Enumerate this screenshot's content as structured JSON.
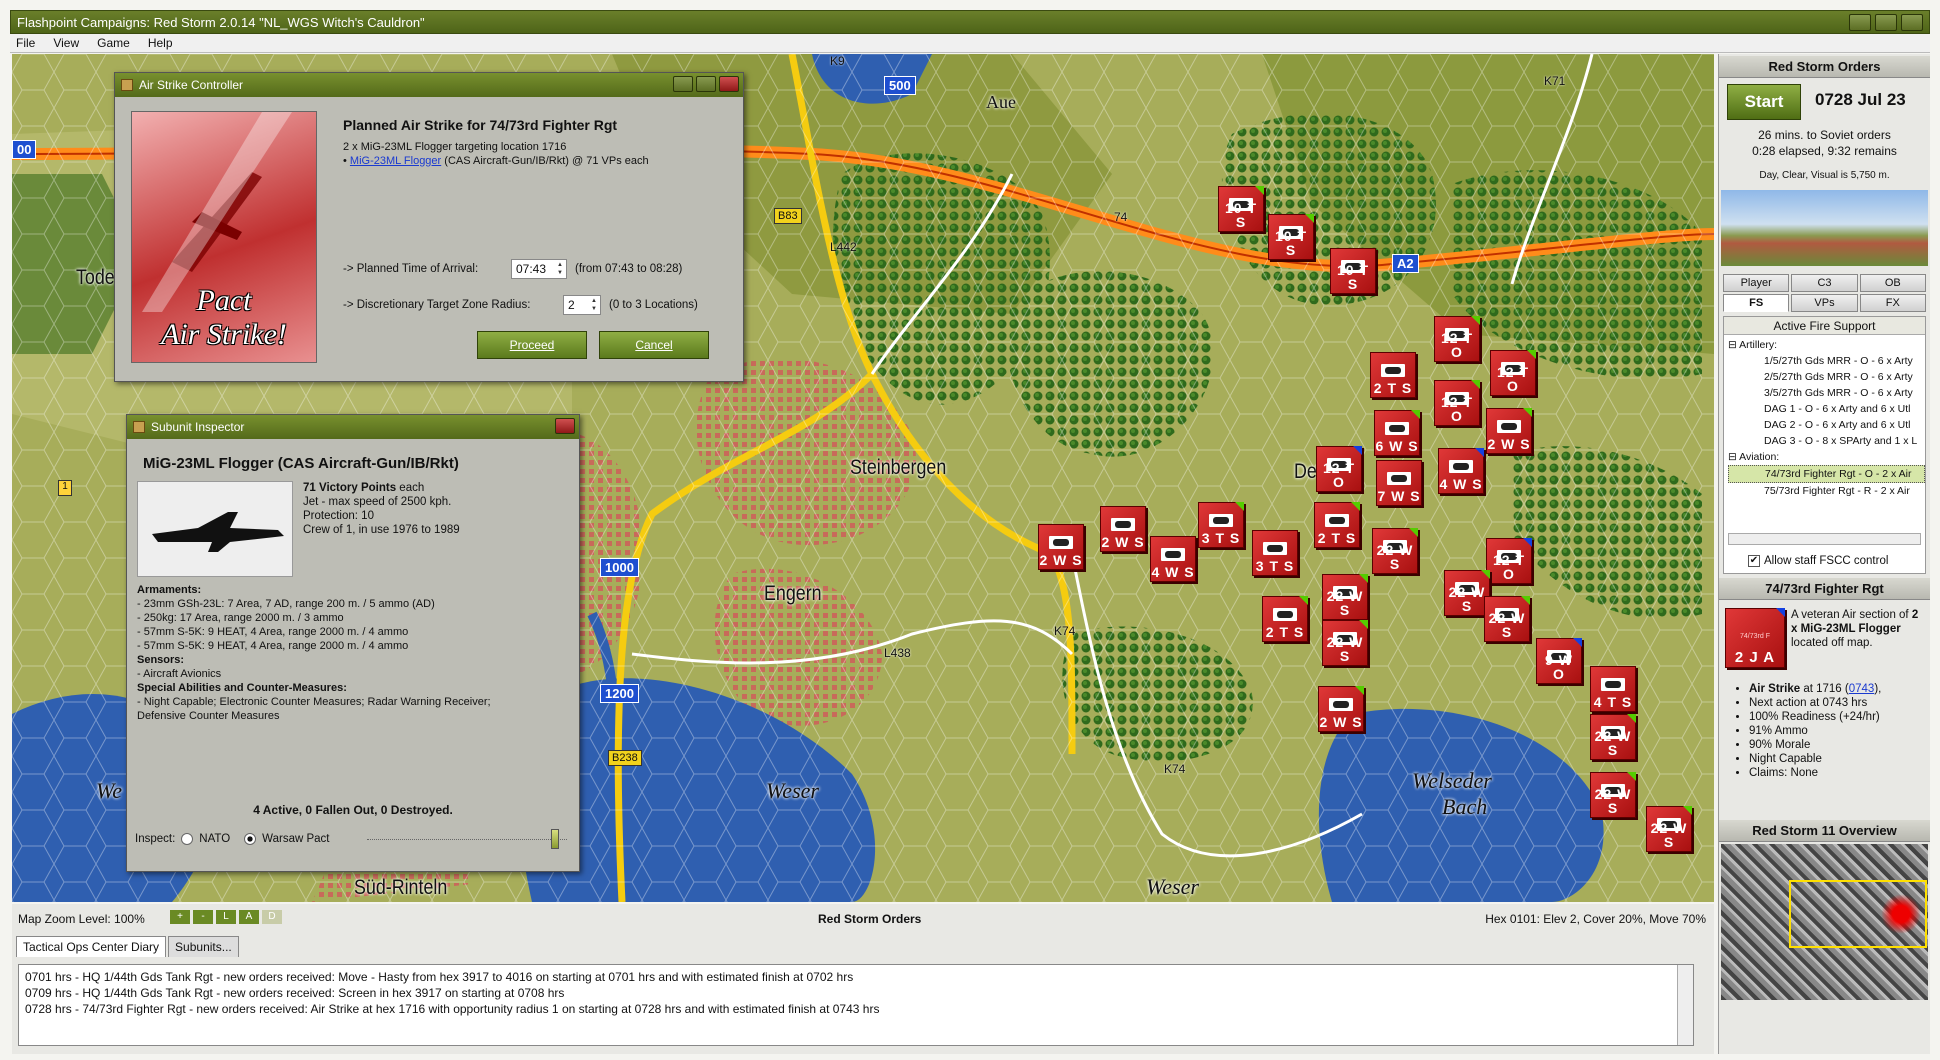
{
  "window": {
    "title": "Flashpoint Campaigns: Red Storm  2.0.14  \"NL_WGS Witch's Cauldron\""
  },
  "menu": [
    "File",
    "View",
    "Game",
    "Help"
  ],
  "map": {
    "places": [
      "Steinbergen",
      "Engern",
      "Süd-Rinteln",
      "Aue",
      "Tode",
      "We",
      "Weser",
      "Weser",
      "Welseder",
      "Bach",
      "De"
    ],
    "roads": [
      "B83",
      "L442",
      "B238",
      "L438",
      "K74",
      "K74",
      "K71",
      "K9",
      "74"
    ],
    "signs": [
      "A2",
      "500",
      "1000",
      "1200",
      "00"
    ],
    "marker": "1"
  },
  "air_strike": {
    "title": "Air Strike Controller",
    "heading": "Planned Air Strike for 74/73rd Fighter Rgt",
    "line1": "2 x MiG-23ML Flogger targeting location 1716",
    "link": "MiG-23ML Flogger",
    "link_rest": " (CAS Aircraft-Gun/IB/Rkt) @ 71 VPs each",
    "image_text1": "Pact",
    "image_text2": "Air Strike!",
    "arrival_label": "-> Planned Time of Arrival:",
    "arrival_value": "07:43",
    "arrival_range": "(from 07:43 to 08:28)",
    "radius_label": "-> Discretionary Target Zone Radius:",
    "radius_value": "2",
    "radius_range": "(0 to 3 Locations)",
    "proceed": "Proceed",
    "cancel": "Cancel"
  },
  "inspector": {
    "title": "Subunit Inspector",
    "heading": "MiG-23ML Flogger  (CAS Aircraft-Gun/IB/Rkt)",
    "vp": "71 Victory Points",
    "vp_each": " each",
    "stats": [
      "Jet - max speed of 2500 kph.",
      "Protection: 10",
      "Crew of 1, in use 1976 to 1989"
    ],
    "armaments_h": "Armaments:",
    "armaments": [
      "- 23mm GSh-23L: 7 Area, 7 AD, range 200 m. / 5 ammo (AD)",
      "- 250kg: 17 Area, range 2000 m. / 3 ammo",
      "- 57mm S-5K: 9 HEAT, 4 Area, range 2000 m. / 4 ammo",
      "- 57mm S-5K: 9 HEAT, 4 Area, range 2000 m. / 4 ammo"
    ],
    "sensors_h": "Sensors:",
    "sensors": [
      "- Aircraft Avionics"
    ],
    "special_h": "Special Abilities and Counter-Measures:",
    "special": [
      "- Night Capable; Electronic Counter Measures; Radar Warning Receiver;",
      "Defensive Counter Measures"
    ],
    "status": "4 Active, 0 Fallen Out, 0 Destroyed.",
    "inspect_label": "Inspect:",
    "nato": "NATO",
    "pact": "Warsaw Pact"
  },
  "units": [
    {
      "t": "10 T S",
      "c": "g"
    },
    {
      "t": "10 T S",
      "c": "g"
    },
    {
      "t": "10 T S",
      "c": ""
    },
    {
      "t": "12 T O",
      "c": "g"
    },
    {
      "t": "12 T O",
      "c": "g"
    },
    {
      "t": "2 T S",
      "c": ""
    },
    {
      "t": "12 T O",
      "c": "g"
    },
    {
      "t": "6 W S",
      "c": "g"
    },
    {
      "t": "2 W S",
      "c": "g"
    },
    {
      "t": "12 T O",
      "c": "b"
    },
    {
      "t": "7 W S",
      "c": ""
    },
    {
      "t": "4 W S",
      "c": "b"
    },
    {
      "t": "2 W S",
      "c": ""
    },
    {
      "t": "2 W S",
      "c": ""
    },
    {
      "t": "4 W S",
      "c": ""
    },
    {
      "t": "3 T S",
      "c": "g"
    },
    {
      "t": "3 T S",
      "c": ""
    },
    {
      "t": "2 T S",
      "c": "g"
    },
    {
      "t": "22 W S",
      "c": "g"
    },
    {
      "t": "22 W S",
      "c": "g"
    },
    {
      "t": "12 T O",
      "c": "b"
    },
    {
      "t": "22 W S",
      "c": "g"
    },
    {
      "t": "2 T S",
      "c": "g"
    },
    {
      "t": "22 W S",
      "c": "g"
    },
    {
      "t": "22 W S",
      "c": "g"
    },
    {
      "t": "9 W O",
      "c": "b"
    },
    {
      "t": "4 T S",
      "c": ""
    },
    {
      "t": "2 W S",
      "c": "g"
    },
    {
      "t": "22 W S",
      "c": "g"
    },
    {
      "t": "22 W S",
      "c": "g"
    },
    {
      "t": "22 W S",
      "c": "g"
    }
  ],
  "sidebar": {
    "orders_title": "Red Storm Orders",
    "start": "Start",
    "datetime": "0728 Jul 23",
    "orders_line1": "26 mins. to Soviet orders",
    "orders_line2": "0:28 elapsed, 9:32 remains",
    "weather": "Day, Clear, Visual is 5,750 m.",
    "tabs_row1": [
      "Player",
      "C3",
      "OB"
    ],
    "tabs_row2": [
      "FS",
      "VPs",
      "FX"
    ],
    "fs_title": "Active Fire Support",
    "tree": [
      "Artillery:",
      "1/5/27th Gds MRR - O - 6 x Arty",
      "2/5/27th Gds MRR - O - 6 x Arty",
      "3/5/27th Gds MRR - O - 6 x Arty",
      "DAG 1 - O - 6 x Arty and 6 x Utl",
      "DAG 2 - O - 6 x Arty and 6 x Utl",
      "DAG 3 - O - 8 x SPArty and 1 x L",
      "Aviation:",
      "74/73rd Fighter Rgt - O - 2 x Air",
      "75/73rd Fighter Rgt - R - 2 x Air"
    ],
    "fscc": "Allow staff FSCC control",
    "unit_title": "74/73rd Fighter Rgt",
    "counter_label": "74/73rd F",
    "counter_ltr": "2 J A",
    "unit_desc1": "A veteran Air section of",
    "unit_desc2": "2 x MiG-23ML Flogger",
    "unit_desc3": " located off map.",
    "bullets": [
      "Air Strike at 1716 (0743),",
      "Next action at 0743 hrs",
      "100% Readiness (+24/hr)",
      "91% Ammo",
      "90% Morale",
      "Night Capable",
      "Claims: None"
    ],
    "overview_title": "Red Storm 11 Overview"
  },
  "bottom": {
    "zoom": "Map Zoom Level: 100%",
    "zoom_btns": [
      "+",
      "-",
      "L",
      "A",
      "D"
    ],
    "center": "Red Storm Orders",
    "hex": "Hex 0101: Elev 2, Cover 20%, Move 70%",
    "tabs": [
      "Tactical Ops Center Diary",
      "Subunits..."
    ],
    "log": [
      "0701 hrs - HQ 1/44th Gds Tank Rgt - new orders received: Move - Hasty from hex 3917 to 4016 on starting at 0701 hrs and with estimated finish at 0702 hrs",
      "0709 hrs - HQ 1/44th Gds Tank Rgt - new orders received: Screen in hex 3917 on starting at 0708 hrs",
      "0728 hrs - 74/73rd Fighter Rgt - new orders received: Air Strike at hex 1716 with opportunity radius 1 on starting at 0728 hrs and with estimated finish at 0743 hrs"
    ]
  },
  "colors": {
    "accent": "#5b7a1c",
    "unit_red": "#c82020",
    "map_green": "#9fa64e",
    "water": "#2f5fb0"
  }
}
